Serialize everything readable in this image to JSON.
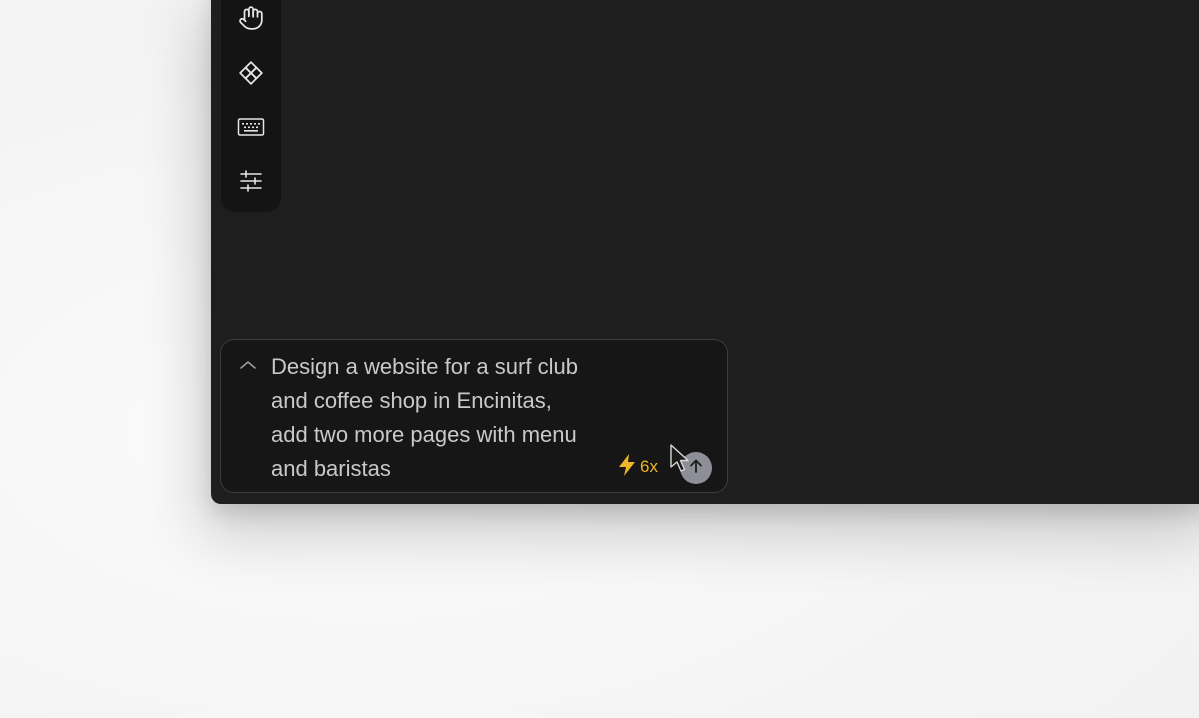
{
  "toolbar": {
    "tools": [
      {
        "name": "hand-tool",
        "icon": "hand-icon"
      },
      {
        "name": "component-tool",
        "icon": "component-diamond-icon"
      },
      {
        "name": "keyboard-tool",
        "icon": "keyboard-icon"
      },
      {
        "name": "settings-tool",
        "icon": "sliders-icon"
      }
    ]
  },
  "prompt": {
    "text": "Design a website for a surf club\nand coffee shop in Encinitas,\nadd two more pages with menu\nand baristas",
    "expand_icon": "chevron-up-icon",
    "credits_icon": "lightning-icon",
    "credits_label": "6x",
    "send_icon": "arrow-up-icon"
  },
  "colors": {
    "canvas": "#1e1e1e",
    "toolbar": "#141414",
    "prompt_bg": "#161616",
    "accent_credits": "#f0b429",
    "send_button": "#8e8e98"
  }
}
